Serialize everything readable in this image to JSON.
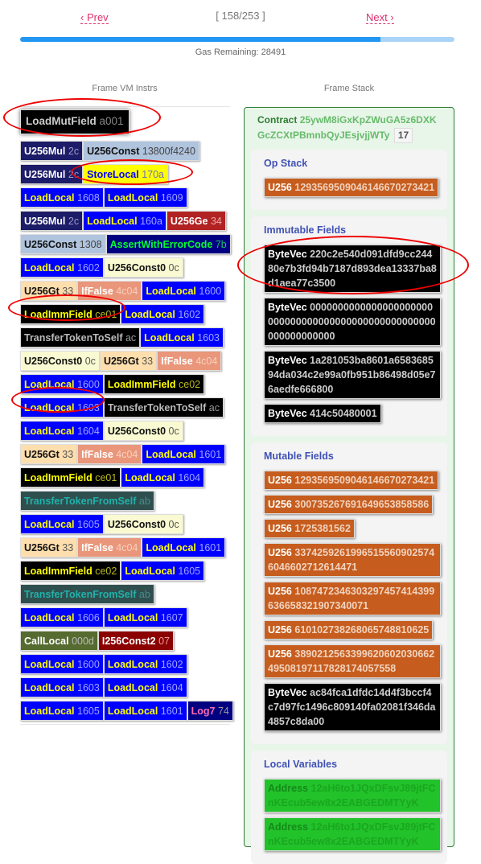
{
  "nav": {
    "prev_label": "‹ Prev",
    "next_label": "Next ›",
    "counter": "[ 158/253 ]",
    "current_step": 158,
    "total_steps": 253
  },
  "progress": {
    "fraction": 0.83,
    "fill_color": "#2196f3",
    "track_color": "#aad4f7"
  },
  "gas_remaining_text": "Gas Remaining: 28491",
  "left_panel": {
    "title": "Frame VM Instrs",
    "current_instr": {
      "op": "LoadMutField",
      "arg": "a001",
      "style": "c-black"
    },
    "rows": [
      [
        {
          "op": "U256Mul",
          "arg": "2c",
          "style": "c-navy"
        },
        {
          "op": "U256Const",
          "arg": "13800f4240",
          "style": "c-steel"
        }
      ],
      [
        {
          "op": "U256Mul",
          "arg": "2c",
          "style": "c-navy"
        },
        {
          "op": "StoreLocal",
          "arg": "170a",
          "style": "c-yellow"
        }
      ],
      [
        {
          "op": "LoadLocal",
          "arg": "1608",
          "style": "c-blue"
        },
        {
          "op": "LoadLocal",
          "arg": "1609",
          "style": "c-blue"
        }
      ],
      [
        {
          "op": "U256Mul",
          "arg": "2c",
          "style": "c-navy"
        },
        {
          "op": "LoadLocal",
          "arg": "160a",
          "style": "c-blue"
        },
        {
          "op": "U256Ge",
          "arg": "34",
          "style": "c-red"
        }
      ],
      [
        {
          "op": "U256Const",
          "arg": "1308",
          "style": "c-steel"
        },
        {
          "op": "AssertWithErrorCode",
          "arg": "7b",
          "style": "c-darkblue"
        }
      ],
      [
        {
          "op": "LoadLocal",
          "arg": "1602",
          "style": "c-blue"
        },
        {
          "op": "U256Const0",
          "arg": "0c",
          "style": "c-cream"
        }
      ],
      [
        {
          "op": "U256Gt",
          "arg": "33",
          "style": "c-peach"
        },
        {
          "op": "IfFalse",
          "arg": "4c04",
          "style": "c-salmon"
        },
        {
          "op": "LoadLocal",
          "arg": "1600",
          "style": "c-blue"
        }
      ],
      [
        {
          "op": "LoadImmField",
          "arg": "ce01",
          "style": "c-black-y"
        },
        {
          "op": "LoadLocal",
          "arg": "1602",
          "style": "c-blue"
        }
      ],
      [
        {
          "op": "TransferTokenToSelf",
          "arg": "ac",
          "style": "c-black-g"
        },
        {
          "op": "LoadLocal",
          "arg": "1603",
          "style": "c-blue"
        }
      ],
      [
        {
          "op": "U256Const0",
          "arg": "0c",
          "style": "c-cream"
        },
        {
          "op": "U256Gt",
          "arg": "33",
          "style": "c-peach"
        },
        {
          "op": "IfFalse",
          "arg": "4c04",
          "style": "c-salmon"
        }
      ],
      [
        {
          "op": "LoadLocal",
          "arg": "1600",
          "style": "c-blue"
        },
        {
          "op": "LoadImmField",
          "arg": "ce02",
          "style": "c-black-y"
        }
      ],
      [
        {
          "op": "LoadLocal",
          "arg": "1603",
          "style": "c-blue"
        },
        {
          "op": "TransferTokenToSelf",
          "arg": "ac",
          "style": "c-black-g"
        }
      ],
      [
        {
          "op": "LoadLocal",
          "arg": "1604",
          "style": "c-blue"
        },
        {
          "op": "U256Const0",
          "arg": "0c",
          "style": "c-cream"
        }
      ],
      [
        {
          "op": "U256Gt",
          "arg": "33",
          "style": "c-peach"
        },
        {
          "op": "IfFalse",
          "arg": "4c04",
          "style": "c-salmon"
        },
        {
          "op": "LoadLocal",
          "arg": "1601",
          "style": "c-blue"
        }
      ],
      [
        {
          "op": "LoadImmField",
          "arg": "ce01",
          "style": "c-black-y"
        },
        {
          "op": "LoadLocal",
          "arg": "1604",
          "style": "c-blue"
        }
      ],
      [
        {
          "op": "TransferTokenFromSelf",
          "arg": "ab",
          "style": "c-slate"
        }
      ],
      [
        {
          "op": "LoadLocal",
          "arg": "1605",
          "style": "c-blue"
        },
        {
          "op": "U256Const0",
          "arg": "0c",
          "style": "c-cream"
        }
      ],
      [
        {
          "op": "U256Gt",
          "arg": "33",
          "style": "c-peach"
        },
        {
          "op": "IfFalse",
          "arg": "4c04",
          "style": "c-salmon"
        },
        {
          "op": "LoadLocal",
          "arg": "1601",
          "style": "c-blue"
        }
      ],
      [
        {
          "op": "LoadImmField",
          "arg": "ce02",
          "style": "c-black-y"
        },
        {
          "op": "LoadLocal",
          "arg": "1605",
          "style": "c-blue"
        }
      ],
      [
        {
          "op": "TransferTokenFromSelf",
          "arg": "ab",
          "style": "c-slate"
        }
      ],
      [
        {
          "op": "LoadLocal",
          "arg": "1606",
          "style": "c-blue"
        },
        {
          "op": "LoadLocal",
          "arg": "1607",
          "style": "c-blue"
        }
      ],
      [
        {
          "op": "CallLocal",
          "arg": "000d",
          "style": "c-olive"
        },
        {
          "op": "I256Const2",
          "arg": "07",
          "style": "c-maroon"
        }
      ],
      [
        {
          "op": "LoadLocal",
          "arg": "1600",
          "style": "c-blue"
        },
        {
          "op": "LoadLocal",
          "arg": "1602",
          "style": "c-blue"
        }
      ],
      [
        {
          "op": "LoadLocal",
          "arg": "1603",
          "style": "c-blue"
        },
        {
          "op": "LoadLocal",
          "arg": "1604",
          "style": "c-blue"
        }
      ],
      [
        {
          "op": "LoadLocal",
          "arg": "1605",
          "style": "c-blue"
        },
        {
          "op": "LoadLocal",
          "arg": "1601",
          "style": "c-blue"
        },
        {
          "op": "Log7",
          "arg": "74",
          "style": "c-log"
        }
      ]
    ]
  },
  "right_panel": {
    "title": "Frame Stack",
    "contract": {
      "label": "Contract",
      "address": "25ywM8iGxKpZWuGA5z6DXKGcZCXtPBmnbQyJEsjvjjWTy",
      "badge": "17"
    },
    "sections": [
      {
        "title": "Op Stack",
        "values": [
          {
            "type": "U256",
            "value": "12935695090461466702734​21",
            "kind": "u256"
          }
        ]
      },
      {
        "title": "Immutable Fields",
        "values": [
          {
            "type": "ByteVec",
            "value": "220c2e540d091dfd9cc24480e7b3fd94b7187d893dea13337ba8d1aea77c3500",
            "kind": "bytevec"
          },
          {
            "type": "ByteVec",
            "value": "0000000000000000000000000000000000000000000000000000000000000000",
            "kind": "bytevec"
          },
          {
            "type": "ByteVec",
            "value": "1a281053ba8601a658368594da034c2e99a0fb951b86498d05e76aedfe666800",
            "kind": "bytevec"
          },
          {
            "type": "ByteVec",
            "value": "414c50480001",
            "kind": "bytevec"
          }
        ]
      },
      {
        "title": "Mutable Fields",
        "values": [
          {
            "type": "U256",
            "value": "1293569509046146670273421",
            "kind": "u256"
          },
          {
            "type": "U256",
            "value": "3007352676916496538585​86",
            "kind": "u256"
          },
          {
            "type": "U256",
            "value": "1725381562",
            "kind": "u256"
          },
          {
            "type": "U256",
            "value": "337425926199651556090257460466027126​14471",
            "kind": "u256"
          },
          {
            "type": "U256",
            "value": "108747234630329745741439963665832190734​0071",
            "kind": "u256"
          },
          {
            "type": "U256",
            "value": "6101027382680657488106​25",
            "kind": "u256"
          },
          {
            "type": "U256",
            "value": "389021256339962060203066249508197117828174057558",
            "kind": "u256"
          },
          {
            "type": "ByteVec",
            "value": "ac84fca1dfdc14d4f3bccf4c7d97fc1496c809140fa02081f346da4857c8da00",
            "kind": "bytevec"
          }
        ]
      },
      {
        "title": "Local Variables",
        "values": [
          {
            "type": "Address",
            "value": "12aH6to1JQxDFsvJ89jtFCnKEcub5ew8x2EABGEDMTYyK",
            "kind": "address"
          },
          {
            "type": "Address",
            "value": "12aH6to1JQxDFsvJ89jtFCnKEcub5ew8x2EABGEDMTYyK",
            "kind": "address"
          }
        ]
      }
    ]
  }
}
